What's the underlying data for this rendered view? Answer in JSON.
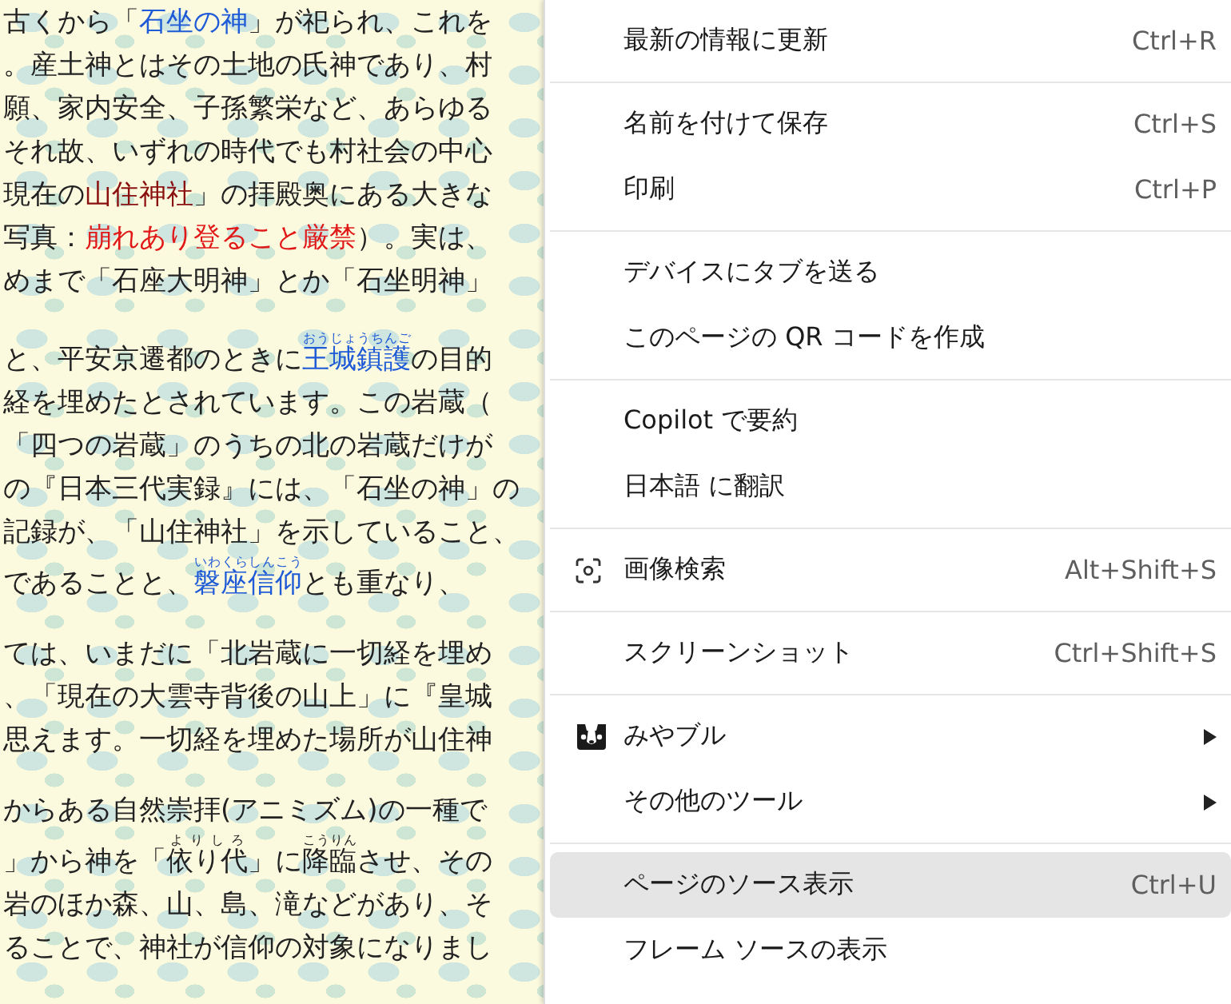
{
  "article": {
    "paragraphs": [
      [
        {
          "segments": [
            {
              "text": "古くから「",
              "kind": "plain"
            },
            {
              "text": "石坐の神",
              "kind": "link"
            },
            {
              "text": "」が祀られ、これを",
              "kind": "plain"
            }
          ]
        },
        {
          "segments": [
            {
              "text": "。産土神とはその土地の氏神であり、村",
              "kind": "plain"
            }
          ]
        },
        {
          "segments": [
            {
              "text": "願、家内安全、子孫繁栄など、あらゆる",
              "kind": "plain"
            }
          ]
        },
        {
          "segments": [
            {
              "text": "それ故、いずれの時代でも村社会の中心",
              "kind": "plain"
            }
          ]
        },
        {
          "segments": [
            {
              "text": "現在の",
              "kind": "plain"
            },
            {
              "text": "山住神社",
              "kind": "name"
            },
            {
              "text": "」の拝殿奥にある大きな",
              "kind": "plain"
            }
          ]
        },
        {
          "segments": [
            {
              "text": "写真：",
              "kind": "plain"
            },
            {
              "text": "崩れあり登ること厳禁",
              "kind": "warning"
            },
            {
              "text": "）。実は、",
              "kind": "plain"
            }
          ]
        },
        {
          "segments": [
            {
              "text": "めまで「石座大明神」とか「石坐明神」",
              "kind": "plain"
            }
          ]
        }
      ],
      [
        {
          "segments": [
            {
              "text": "と、平安京遷都のときに",
              "kind": "plain"
            },
            {
              "text": "王城鎮護",
              "kind": "link",
              "ruby": "おうじょうちんご"
            },
            {
              "text": "の目的",
              "kind": "plain"
            }
          ]
        },
        {
          "segments": [
            {
              "text": "経を埋めたとされています。この岩蔵（",
              "kind": "plain"
            }
          ]
        },
        {
          "segments": [
            {
              "text": "「四つの岩蔵」のうちの北の岩蔵だけが",
              "kind": "plain"
            }
          ]
        },
        {
          "segments": [
            {
              "text": "の『日本三代実録』には、「石坐の神」の",
              "kind": "plain"
            }
          ]
        },
        {
          "segments": [
            {
              "text": "記録が、「山住神社」を示していること、",
              "kind": "plain"
            }
          ]
        },
        {
          "segments": [
            {
              "text": "であることと、",
              "kind": "plain"
            },
            {
              "text": "磐座信仰",
              "kind": "link",
              "ruby": "いわくらしんこう"
            },
            {
              "text": "とも重なり、",
              "kind": "plain"
            }
          ]
        }
      ],
      [
        {
          "segments": [
            {
              "text": "ては、いまだに「北岩蔵に一切経を埋め",
              "kind": "plain"
            }
          ]
        },
        {
          "segments": [
            {
              "text": "、「現在の大雲寺背後の山上」に『皇城",
              "kind": "plain"
            }
          ]
        },
        {
          "segments": [
            {
              "text": "思えます。一切経を埋めた場所が山住神",
              "kind": "plain"
            }
          ]
        }
      ],
      [
        {
          "segments": [
            {
              "text": "からある自然崇拝(アニミズム)の一種で",
              "kind": "plain"
            }
          ]
        },
        {
          "segments": [
            {
              "text": "」から神を「",
              "kind": "plain"
            },
            {
              "text": "依り代",
              "kind": "plain",
              "ruby": "よりしろ"
            },
            {
              "text": "」に",
              "kind": "plain"
            },
            {
              "text": "降臨",
              "kind": "plain",
              "ruby": "こうりん"
            },
            {
              "text": "させ、その",
              "kind": "plain"
            }
          ]
        },
        {
          "segments": [
            {
              "text": "岩のほか森、山、島、滝などがあり、そ",
              "kind": "plain"
            }
          ]
        },
        {
          "segments": [
            {
              "text": "ることで、神社が信仰の対象になりまし",
              "kind": "plain"
            }
          ]
        }
      ]
    ]
  },
  "context_menu": {
    "groups": [
      [
        {
          "label": "最新の情報に更新",
          "shortcut": "Ctrl+R",
          "kind": "plain",
          "submenu": false,
          "selected": false
        }
      ],
      [
        {
          "label": "名前を付けて保存",
          "shortcut": "Ctrl+S",
          "kind": "plain",
          "submenu": false,
          "selected": false
        },
        {
          "label": "印刷",
          "shortcut": "Ctrl+P",
          "kind": "plain",
          "submenu": false,
          "selected": false
        }
      ],
      [
        {
          "label": "デバイスにタブを送る",
          "kind": "plain",
          "submenu": false,
          "selected": false
        },
        {
          "label": "このページの QR コードを作成",
          "kind": "plain",
          "submenu": false,
          "selected": false
        }
      ],
      [
        {
          "label": "Copilot で要約",
          "kind": "plain",
          "submenu": false,
          "selected": false
        },
        {
          "label": "日本語 に翻訳",
          "kind": "plain",
          "submenu": false,
          "selected": false
        }
      ],
      [
        {
          "label": "画像検索",
          "shortcut": "Alt+Shift+S",
          "kind": "lens",
          "submenu": false,
          "selected": false
        }
      ],
      [
        {
          "label": "スクリーンショット",
          "shortcut": "Ctrl+Shift+S",
          "kind": "plain",
          "submenu": false,
          "selected": false
        }
      ],
      [
        {
          "label": "みやブル",
          "kind": "extension",
          "submenu": true,
          "selected": false
        },
        {
          "label": "その他のツール",
          "kind": "plain",
          "submenu": true,
          "selected": false
        }
      ],
      [
        {
          "label": "ページのソース表示",
          "shortcut": "Ctrl+U",
          "kind": "plain",
          "submenu": false,
          "selected": true
        },
        {
          "label": "フレーム ソースの表示",
          "kind": "plain",
          "submenu": false,
          "selected": false
        }
      ]
    ]
  }
}
